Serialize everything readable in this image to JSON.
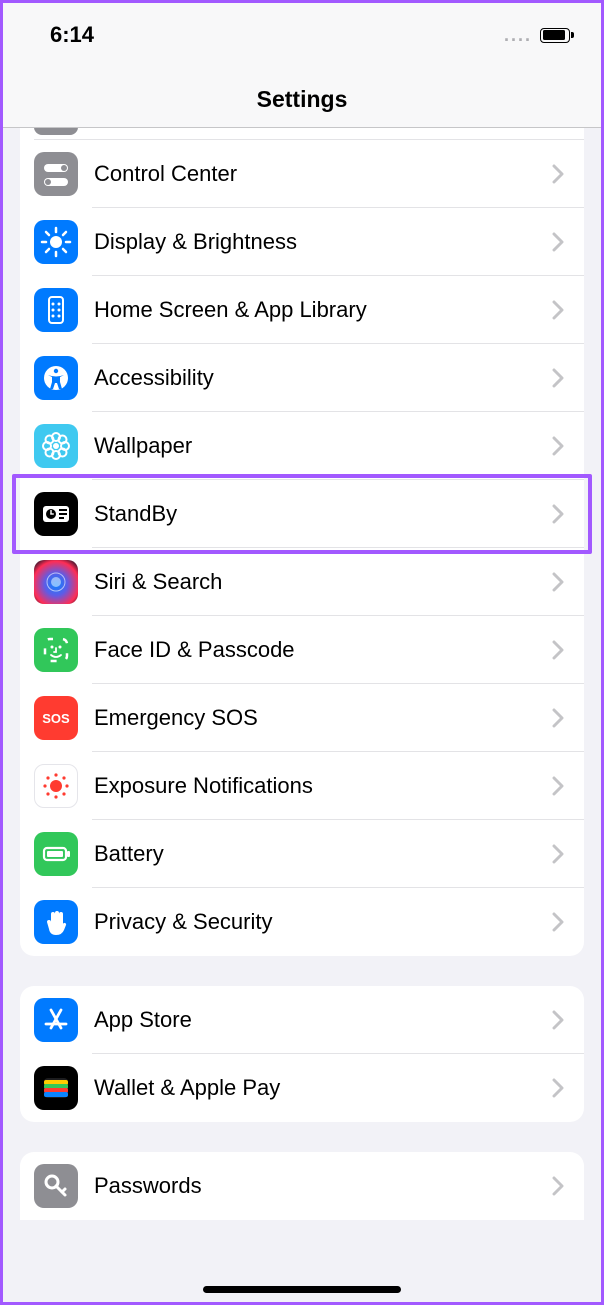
{
  "status": {
    "time": "6:14",
    "cell_dots": "....",
    "battery_level_pct": 85
  },
  "header": {
    "title": "Settings"
  },
  "groups": {
    "main": [
      {
        "id": "control-center",
        "label": "Control Center",
        "icon": "toggle-switches-icon",
        "bg": "bg-gray"
      },
      {
        "id": "display-brightness",
        "label": "Display & Brightness",
        "icon": "sun-icon",
        "bg": "bg-blue"
      },
      {
        "id": "home-screen",
        "label": "Home Screen & App Library",
        "icon": "grid-phone-icon",
        "bg": "bg-blue"
      },
      {
        "id": "accessibility",
        "label": "Accessibility",
        "icon": "accessibility-icon",
        "bg": "bg-blue"
      },
      {
        "id": "wallpaper",
        "label": "Wallpaper",
        "icon": "flower-icon",
        "bg": "bg-cyan"
      },
      {
        "id": "standby",
        "label": "StandBy",
        "icon": "clock-card-icon",
        "bg": "bg-black"
      },
      {
        "id": "siri",
        "label": "Siri & Search",
        "icon": "siri-icon",
        "bg": "bg-siri"
      },
      {
        "id": "faceid",
        "label": "Face ID & Passcode",
        "icon": "faceid-icon",
        "bg": "bg-green"
      },
      {
        "id": "emergency-sos",
        "label": "Emergency SOS",
        "icon": "sos-text-icon",
        "bg": "bg-red",
        "icon_text": "SOS"
      },
      {
        "id": "exposure",
        "label": "Exposure Notifications",
        "icon": "virus-dot-icon",
        "bg": "bg-white"
      },
      {
        "id": "battery",
        "label": "Battery",
        "icon": "battery-icon",
        "bg": "bg-green"
      },
      {
        "id": "privacy",
        "label": "Privacy & Security",
        "icon": "hand-icon",
        "bg": "bg-blue"
      }
    ],
    "store": [
      {
        "id": "app-store",
        "label": "App Store",
        "icon": "appstore-icon",
        "bg": "bg-blue"
      },
      {
        "id": "wallet",
        "label": "Wallet & Apple Pay",
        "icon": "wallet-icon",
        "bg": "bg-black"
      }
    ],
    "passwords": [
      {
        "id": "passwords",
        "label": "Passwords",
        "icon": "key-icon",
        "bg": "bg-gray"
      }
    ]
  },
  "highlight": {
    "target_id": "standby"
  }
}
